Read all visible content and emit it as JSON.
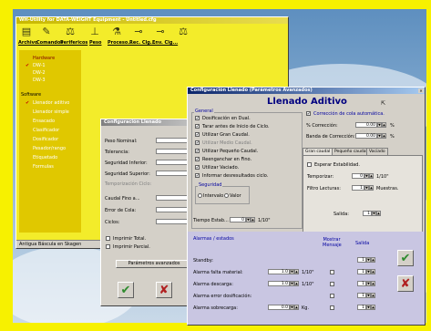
{
  "main_window": {
    "title": "WH-Utility for DATA-WEIGHT Equipment - Untitled.cfg",
    "toolbar": [
      {
        "label": "Archivo",
        "icon": "file-icon"
      },
      {
        "label": "Comandos",
        "icon": "edit-icon"
      },
      {
        "label": "Perifericos",
        "icon": "scale-icon"
      },
      {
        "label": "Peso",
        "icon": "weight-icon"
      },
      {
        "label": "Proceso...",
        "icon": "flask-icon"
      },
      {
        "label": "Rec. Clg...",
        "icon": "gun-icon"
      },
      {
        "label": "Env. Clg...",
        "icon": "gun-icon"
      },
      {
        "label": "",
        "icon": "balance-icon"
      }
    ],
    "tree": {
      "hardware": "Hardware",
      "hw_items": [
        "DW-1",
        "DW-2",
        "DW-3"
      ],
      "software": "Software",
      "sw_items": [
        "Llenador aditivo",
        "Llenador simple",
        "Ensacado",
        "Clasificador",
        "Dosificador",
        "Pesador/rango",
        "Etiquetado",
        "Formulas"
      ]
    },
    "status": "Antigua Báscula en Skagen"
  },
  "llenado_window": {
    "title": "Configuración Llenado",
    "fields": [
      {
        "label": "Peso Nominal:"
      },
      {
        "label": "Tolerancia:"
      },
      {
        "label": "Seguridad Inferior:"
      },
      {
        "label": "Seguridad Superior:"
      },
      {
        "label": "Temporización Ciclo:"
      },
      {
        "label": "Caudal Fino a..."
      },
      {
        "label": "Error de Cola:"
      },
      {
        "label": "Ciclos:"
      }
    ],
    "imprimir_total": "Imprimir Total.",
    "imprimir_parcial": "Imprimir Parcial.",
    "advanced_button": "Parámetros avanzados"
  },
  "advanced_window": {
    "title": "Configuración Llenado (Parámetros Avanzados)",
    "heading": "Llenado Aditivo",
    "general_label": "General",
    "checks": [
      {
        "label": "Dosificación en Dual.",
        "checked": true
      },
      {
        "label": "Tarar antes de Inicio de Ciclo.",
        "checked": true
      },
      {
        "label": "Utilizar Gran Caudal.",
        "checked": true
      },
      {
        "label": "Utilizar Medio Caudal.",
        "checked": true
      },
      {
        "label": "Utilizar Pequeño Caudal.",
        "checked": true
      },
      {
        "label": "Reenganchar en Fino.",
        "checked": true
      },
      {
        "label": "Utilizar Vaciado.",
        "checked": true
      },
      {
        "label": "Informar desresultados ciclo.",
        "checked": true
      }
    ],
    "seguridad_label": "Seguridad",
    "seg_options": [
      "Intervalo",
      "Valor"
    ],
    "tiempo_label": "Tiempo Estab...",
    "tiempo_value": "0",
    "tiempo_unit": "1/10\"",
    "correction": {
      "auto_label": "Corrección de cola automática.",
      "pct_label": "% Corrección:",
      "pct_value": "0.00",
      "pct_unit": "%",
      "band_label": "Banda de Corrección:",
      "band_value": "0.00",
      "band_unit": "%"
    },
    "tabs": [
      "Gran caudal",
      "Pequeño caudal",
      "Vaciado"
    ],
    "tab_content": {
      "esperar_label": "Esperar Estabilidad.",
      "temp_label": "Temporizar:",
      "temp_value": "0",
      "temp_unit": "1/10\"",
      "filtro_label": "Filtro Lecturas:",
      "filtro_value": "1",
      "filtro_unit": "Muestras.",
      "salida_label": "Salida:",
      "salida_value": "1"
    },
    "alarms": {
      "title": "Alarmas / estados",
      "col_mostrar": "Mostrar Mensaje",
      "col_salida": "Salida",
      "rows": [
        {
          "label": "Standby:",
          "value": "",
          "unit": "",
          "salida": "1"
        },
        {
          "label": "Alarma falta material:",
          "value": "1.0",
          "unit": "1/10\"",
          "salida": "1"
        },
        {
          "label": "Alarma descarga:",
          "value": "1.0",
          "unit": "1/10\"",
          "salida": "1"
        },
        {
          "label": "Alarma error dosificación:",
          "value": "",
          "unit": "",
          "salida": "1"
        },
        {
          "label": "Alarma sobrecarga:",
          "value": "0.0",
          "unit": "Kg.",
          "salida": "1"
        }
      ]
    }
  },
  "icons": {
    "ok": "✔",
    "cancel": "✘"
  },
  "colors": {
    "frame": "#f7f100",
    "main_window": "#f3ec2a",
    "titlebar": "#0a246a",
    "ok_green": "#2e8b2e",
    "cancel_red": "#b02020",
    "group_blue": "#0000a0"
  }
}
